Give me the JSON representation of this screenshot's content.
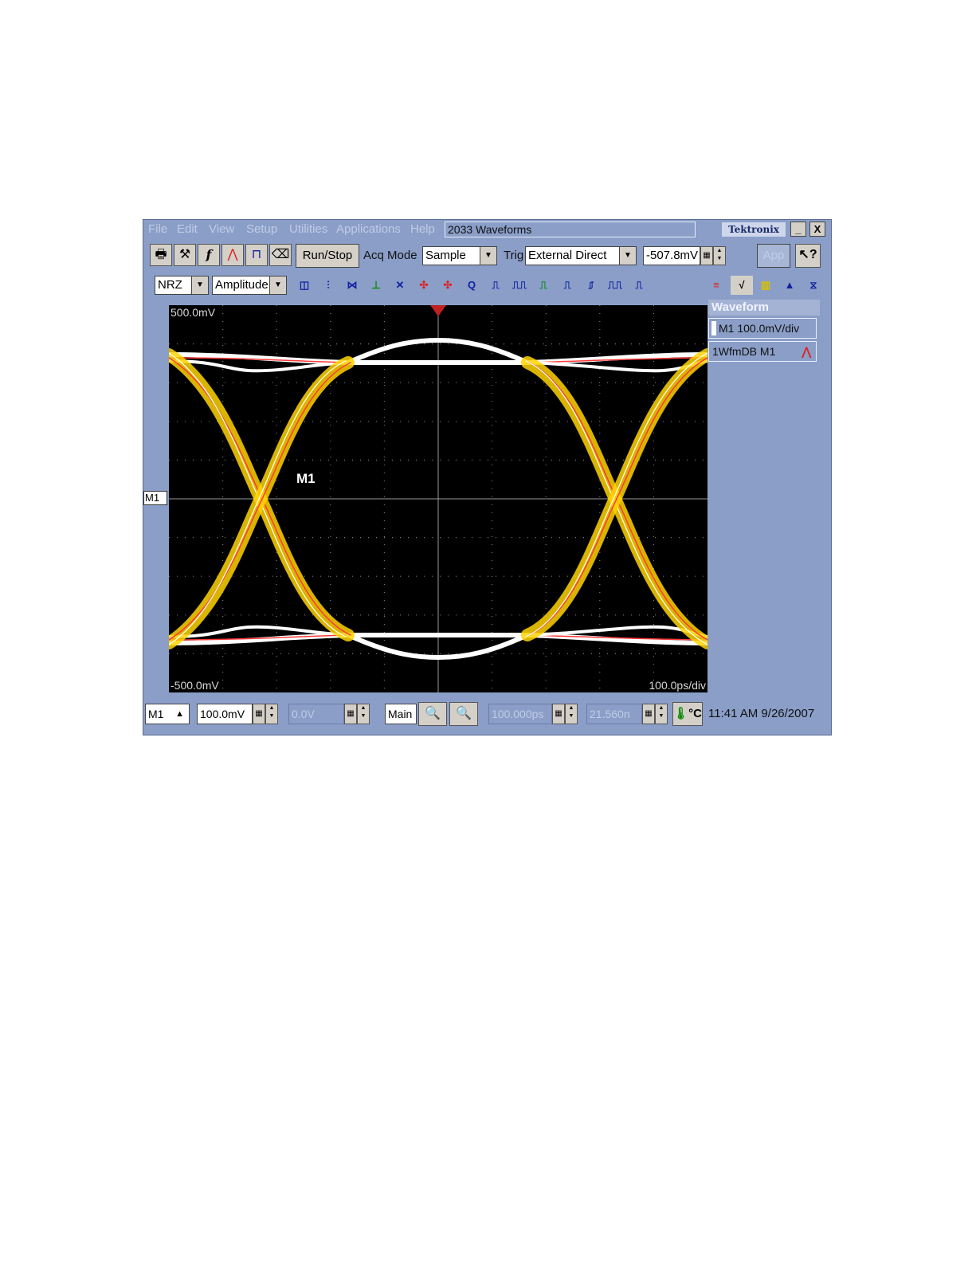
{
  "menubar": {
    "items": [
      "File",
      "Edit",
      "View",
      "Setup",
      "Utilities",
      "Applications",
      "Help"
    ],
    "title": "2033 Waveforms",
    "brand": "Tektronix",
    "minimize": "_",
    "close": "X"
  },
  "toolbar": {
    "run_stop": "Run/Stop",
    "acq_mode_label": "Acq Mode",
    "acq_mode_value": "Sample",
    "trig_label": "Trig",
    "trig_value": "External Direct",
    "trig_level": "-507.8mV",
    "app_label": "App"
  },
  "toolbar2": {
    "signal_type": "NRZ",
    "measurement": "Amplitude"
  },
  "screen": {
    "top_label": "500.0mV",
    "bottom_label": "-500.0mV",
    "timebase_label": "100.0ps/div",
    "trace_label": "M1",
    "marker_label": "M1"
  },
  "side_panel": {
    "header": "Waveform",
    "row1": "M1 100.0mV/div",
    "row2_index": "1",
    "row2": "WfmDB M1"
  },
  "bottom": {
    "source": "M1",
    "scale": "100.0mV",
    "offset": "0.0V",
    "view": "Main",
    "position": "100.000ps",
    "horizontal": "21.560n",
    "temp_unit": "°C",
    "datetime": "11:41 AM 9/26/2007"
  },
  "colors": {
    "frame": "#8a9ec8",
    "screen_bg": "#000000",
    "trace_primary": "#ffd400",
    "trace_secondary": "#ff3a3a",
    "trace_white": "#ffffff"
  }
}
